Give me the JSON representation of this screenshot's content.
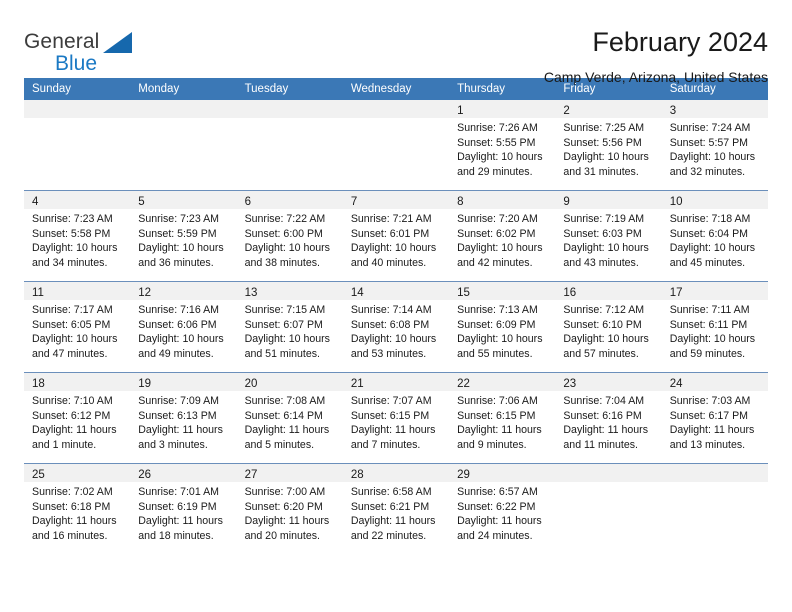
{
  "brand": {
    "name_top": "General",
    "name_bottom": "Blue",
    "accent_color": "#1668ad",
    "triangle_icon": "triangle-icon"
  },
  "header": {
    "title": "February 2024",
    "subtitle": "Camp Verde, Arizona, United States"
  },
  "theme": {
    "header_row_bg": "#3b78b6",
    "daynum_band_bg": "#f1f1f1",
    "row_divider": "#6b8fbb",
    "text": "#1a1a1a"
  },
  "calendar": {
    "weekday_headers": [
      "Sunday",
      "Monday",
      "Tuesday",
      "Wednesday",
      "Thursday",
      "Friday",
      "Saturday"
    ],
    "weeks": [
      [
        {
          "day": "",
          "lines": []
        },
        {
          "day": "",
          "lines": []
        },
        {
          "day": "",
          "lines": []
        },
        {
          "day": "",
          "lines": []
        },
        {
          "day": "1",
          "lines": [
            "Sunrise: 7:26 AM",
            "Sunset: 5:55 PM",
            "Daylight: 10 hours",
            "and 29 minutes."
          ]
        },
        {
          "day": "2",
          "lines": [
            "Sunrise: 7:25 AM",
            "Sunset: 5:56 PM",
            "Daylight: 10 hours",
            "and 31 minutes."
          ]
        },
        {
          "day": "3",
          "lines": [
            "Sunrise: 7:24 AM",
            "Sunset: 5:57 PM",
            "Daylight: 10 hours",
            "and 32 minutes."
          ]
        }
      ],
      [
        {
          "day": "4",
          "lines": [
            "Sunrise: 7:23 AM",
            "Sunset: 5:58 PM",
            "Daylight: 10 hours",
            "and 34 minutes."
          ]
        },
        {
          "day": "5",
          "lines": [
            "Sunrise: 7:23 AM",
            "Sunset: 5:59 PM",
            "Daylight: 10 hours",
            "and 36 minutes."
          ]
        },
        {
          "day": "6",
          "lines": [
            "Sunrise: 7:22 AM",
            "Sunset: 6:00 PM",
            "Daylight: 10 hours",
            "and 38 minutes."
          ]
        },
        {
          "day": "7",
          "lines": [
            "Sunrise: 7:21 AM",
            "Sunset: 6:01 PM",
            "Daylight: 10 hours",
            "and 40 minutes."
          ]
        },
        {
          "day": "8",
          "lines": [
            "Sunrise: 7:20 AM",
            "Sunset: 6:02 PM",
            "Daylight: 10 hours",
            "and 42 minutes."
          ]
        },
        {
          "day": "9",
          "lines": [
            "Sunrise: 7:19 AM",
            "Sunset: 6:03 PM",
            "Daylight: 10 hours",
            "and 43 minutes."
          ]
        },
        {
          "day": "10",
          "lines": [
            "Sunrise: 7:18 AM",
            "Sunset: 6:04 PM",
            "Daylight: 10 hours",
            "and 45 minutes."
          ]
        }
      ],
      [
        {
          "day": "11",
          "lines": [
            "Sunrise: 7:17 AM",
            "Sunset: 6:05 PM",
            "Daylight: 10 hours",
            "and 47 minutes."
          ]
        },
        {
          "day": "12",
          "lines": [
            "Sunrise: 7:16 AM",
            "Sunset: 6:06 PM",
            "Daylight: 10 hours",
            "and 49 minutes."
          ]
        },
        {
          "day": "13",
          "lines": [
            "Sunrise: 7:15 AM",
            "Sunset: 6:07 PM",
            "Daylight: 10 hours",
            "and 51 minutes."
          ]
        },
        {
          "day": "14",
          "lines": [
            "Sunrise: 7:14 AM",
            "Sunset: 6:08 PM",
            "Daylight: 10 hours",
            "and 53 minutes."
          ]
        },
        {
          "day": "15",
          "lines": [
            "Sunrise: 7:13 AM",
            "Sunset: 6:09 PM",
            "Daylight: 10 hours",
            "and 55 minutes."
          ]
        },
        {
          "day": "16",
          "lines": [
            "Sunrise: 7:12 AM",
            "Sunset: 6:10 PM",
            "Daylight: 10 hours",
            "and 57 minutes."
          ]
        },
        {
          "day": "17",
          "lines": [
            "Sunrise: 7:11 AM",
            "Sunset: 6:11 PM",
            "Daylight: 10 hours",
            "and 59 minutes."
          ]
        }
      ],
      [
        {
          "day": "18",
          "lines": [
            "Sunrise: 7:10 AM",
            "Sunset: 6:12 PM",
            "Daylight: 11 hours",
            "and 1 minute."
          ]
        },
        {
          "day": "19",
          "lines": [
            "Sunrise: 7:09 AM",
            "Sunset: 6:13 PM",
            "Daylight: 11 hours",
            "and 3 minutes."
          ]
        },
        {
          "day": "20",
          "lines": [
            "Sunrise: 7:08 AM",
            "Sunset: 6:14 PM",
            "Daylight: 11 hours",
            "and 5 minutes."
          ]
        },
        {
          "day": "21",
          "lines": [
            "Sunrise: 7:07 AM",
            "Sunset: 6:15 PM",
            "Daylight: 11 hours",
            "and 7 minutes."
          ]
        },
        {
          "day": "22",
          "lines": [
            "Sunrise: 7:06 AM",
            "Sunset: 6:15 PM",
            "Daylight: 11 hours",
            "and 9 minutes."
          ]
        },
        {
          "day": "23",
          "lines": [
            "Sunrise: 7:04 AM",
            "Sunset: 6:16 PM",
            "Daylight: 11 hours",
            "and 11 minutes."
          ]
        },
        {
          "day": "24",
          "lines": [
            "Sunrise: 7:03 AM",
            "Sunset: 6:17 PM",
            "Daylight: 11 hours",
            "and 13 minutes."
          ]
        }
      ],
      [
        {
          "day": "25",
          "lines": [
            "Sunrise: 7:02 AM",
            "Sunset: 6:18 PM",
            "Daylight: 11 hours",
            "and 16 minutes."
          ]
        },
        {
          "day": "26",
          "lines": [
            "Sunrise: 7:01 AM",
            "Sunset: 6:19 PM",
            "Daylight: 11 hours",
            "and 18 minutes."
          ]
        },
        {
          "day": "27",
          "lines": [
            "Sunrise: 7:00 AM",
            "Sunset: 6:20 PM",
            "Daylight: 11 hours",
            "and 20 minutes."
          ]
        },
        {
          "day": "28",
          "lines": [
            "Sunrise: 6:58 AM",
            "Sunset: 6:21 PM",
            "Daylight: 11 hours",
            "and 22 minutes."
          ]
        },
        {
          "day": "29",
          "lines": [
            "Sunrise: 6:57 AM",
            "Sunset: 6:22 PM",
            "Daylight: 11 hours",
            "and 24 minutes."
          ]
        },
        {
          "day": "",
          "lines": []
        },
        {
          "day": "",
          "lines": []
        }
      ]
    ]
  }
}
